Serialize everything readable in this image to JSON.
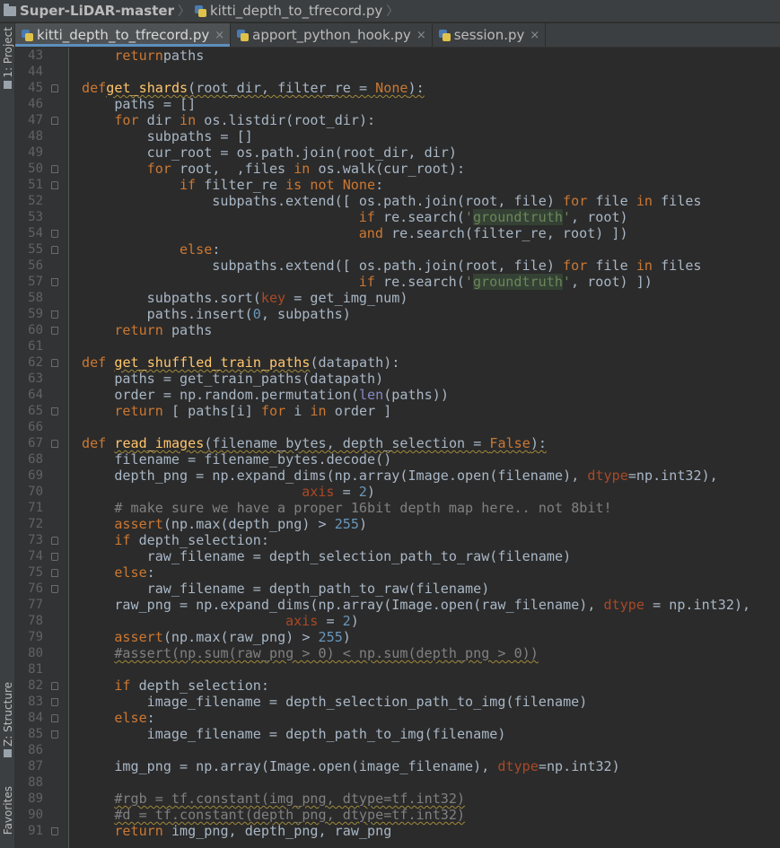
{
  "breadcrumb": {
    "project": "Super-LiDAR-master",
    "file": "kitti_depth_to_tfrecord.py"
  },
  "tool_strip": {
    "project": "1: Project",
    "structure": "Z: Structure",
    "favorites": "Favorites"
  },
  "tabs": [
    {
      "label": "kitti_depth_to_tfrecord.py",
      "active": true
    },
    {
      "label": "apport_python_hook.py",
      "active": false
    },
    {
      "label": "session.py",
      "active": false
    }
  ],
  "colors": {
    "keyword": "#cc7832",
    "function": "#ffc66d",
    "number": "#6897bb",
    "string": "#6a8759",
    "comment": "#808080",
    "kwarg": "#aa4926",
    "builtin": "#8888c6",
    "text": "#a9b7c6",
    "background": "#2b2b2b"
  },
  "lines": [
    {
      "n": 43,
      "ind": 1,
      "t": [
        [
          "kw",
          "return"
        ],
        [
          "",
          "paths"
        ]
      ]
    },
    {
      "n": 44,
      "ind": 0,
      "t": []
    },
    {
      "n": 45,
      "ind": 0,
      "t": [
        [
          "kw",
          "def"
        ],
        [
          "fn sq",
          "get_shards"
        ],
        [
          "sq",
          "(root_dir, filter_re = "
        ],
        [
          "kw sq",
          "None"
        ],
        [
          "sq",
          "):"
        ]
      ]
    },
    {
      "n": 46,
      "ind": 1,
      "t": [
        [
          "",
          "paths = []"
        ]
      ]
    },
    {
      "n": 47,
      "ind": 1,
      "t": [
        [
          "kw",
          "for "
        ],
        [
          "",
          "dir "
        ],
        [
          "kw",
          "in "
        ],
        [
          "",
          "os.listdir(root_dir):"
        ]
      ]
    },
    {
      "n": 48,
      "ind": 2,
      "t": [
        [
          "",
          "subpaths = []"
        ]
      ]
    },
    {
      "n": 49,
      "ind": 2,
      "t": [
        [
          "",
          "cur_root = os.path.join(root_dir, dir)"
        ]
      ]
    },
    {
      "n": 50,
      "ind": 2,
      "t": [
        [
          "kw",
          "for "
        ],
        [
          "",
          "root,  ,files "
        ],
        [
          "kw",
          "in "
        ],
        [
          "",
          "os.walk(cur_root):"
        ]
      ]
    },
    {
      "n": 51,
      "ind": 3,
      "t": [
        [
          "kw",
          "if "
        ],
        [
          "",
          "filter_re "
        ],
        [
          "kw",
          "is not "
        ],
        [
          "kw",
          "None"
        ],
        [
          "",
          ":"
        ]
      ]
    },
    {
      "n": 52,
      "ind": 4,
      "t": [
        [
          "",
          "subpaths.extend([ os.path.join(root, file) "
        ],
        [
          "kw",
          "for "
        ],
        [
          "",
          "file "
        ],
        [
          "kw",
          "in "
        ],
        [
          "",
          "files"
        ]
      ]
    },
    {
      "n": 53,
      "ind": 8.5,
      "t": [
        [
          "kw",
          "if "
        ],
        [
          "",
          "re.search("
        ],
        [
          "str",
          "'"
        ],
        [
          "str hl",
          "groundtruth"
        ],
        [
          "str",
          "'"
        ],
        [
          "",
          ", root)"
        ]
      ]
    },
    {
      "n": 54,
      "ind": 8.5,
      "t": [
        [
          "kw",
          "and "
        ],
        [
          "",
          "re.search(filter_re, root) ])"
        ]
      ]
    },
    {
      "n": 55,
      "ind": 3,
      "t": [
        [
          "kw",
          "else"
        ],
        [
          "",
          ":"
        ]
      ]
    },
    {
      "n": 56,
      "ind": 4,
      "t": [
        [
          "",
          "subpaths.extend([ os.path.join(root, file) "
        ],
        [
          "kw",
          "for "
        ],
        [
          "",
          "file "
        ],
        [
          "kw",
          "in "
        ],
        [
          "",
          "files"
        ]
      ]
    },
    {
      "n": 57,
      "ind": 8.5,
      "t": [
        [
          "kw",
          "if "
        ],
        [
          "",
          "re.search("
        ],
        [
          "str",
          "'"
        ],
        [
          "str hl",
          "groundtruth"
        ],
        [
          "str",
          "'"
        ],
        [
          "",
          ", root) ])"
        ]
      ]
    },
    {
      "n": 58,
      "ind": 2,
      "t": [
        [
          "",
          "subpaths.sort("
        ],
        [
          "kwarg",
          "key"
        ],
        [
          "",
          " = get_img_num)"
        ]
      ]
    },
    {
      "n": 59,
      "ind": 2,
      "t": [
        [
          "",
          "paths.insert("
        ],
        [
          "num",
          "0"
        ],
        [
          "",
          ", subpaths)"
        ]
      ]
    },
    {
      "n": 60,
      "ind": 1,
      "t": [
        [
          "kw",
          "return "
        ],
        [
          "",
          "paths"
        ]
      ]
    },
    {
      "n": 61,
      "ind": 0,
      "t": []
    },
    {
      "n": 62,
      "ind": 0,
      "t": [
        [
          "kw",
          "def "
        ],
        [
          "fn sq",
          "get_shuffled_train_paths"
        ],
        [
          "",
          "(datapath):"
        ]
      ]
    },
    {
      "n": 63,
      "ind": 1,
      "t": [
        [
          "",
          "paths = get_train_paths(datapath)"
        ]
      ]
    },
    {
      "n": 64,
      "ind": 1,
      "t": [
        [
          "",
          "order = np.random.permutation("
        ],
        [
          "bi",
          "len"
        ],
        [
          "",
          "(paths))"
        ]
      ]
    },
    {
      "n": 65,
      "ind": 1,
      "t": [
        [
          "kw",
          "return "
        ],
        [
          "",
          "[ paths[i] "
        ],
        [
          "kw",
          "for "
        ],
        [
          "",
          "i "
        ],
        [
          "kw",
          "in "
        ],
        [
          "",
          "order ]"
        ]
      ]
    },
    {
      "n": 66,
      "ind": 0,
      "t": []
    },
    {
      "n": 67,
      "ind": 0,
      "t": [
        [
          "kw",
          "def "
        ],
        [
          "fn sq",
          "read_images"
        ],
        [
          "sq",
          "(filename_bytes, depth_selection = "
        ],
        [
          "kw sq",
          "False"
        ],
        [
          "sq",
          "):"
        ]
      ]
    },
    {
      "n": 68,
      "ind": 1,
      "t": [
        [
          "",
          "filename = filename_bytes.decode()"
        ]
      ]
    },
    {
      "n": 69,
      "ind": 1,
      "t": [
        [
          "",
          "depth_png = np.expand_dims(np.array(Image.open(filename), "
        ],
        [
          "kwarg",
          "dtype"
        ],
        [
          "",
          "=np.int32),"
        ]
      ]
    },
    {
      "n": 70,
      "ind": 6.75,
      "t": [
        [
          "kwarg",
          "axis"
        ],
        [
          "",
          " = "
        ],
        [
          "num",
          "2"
        ],
        [
          "",
          ")"
        ]
      ]
    },
    {
      "n": 71,
      "ind": 1,
      "t": [
        [
          "cm",
          "# make sure we have a proper 16bit depth map here.. not 8bit!"
        ]
      ]
    },
    {
      "n": 72,
      "ind": 1,
      "t": [
        [
          "kw",
          "assert"
        ],
        [
          "",
          "(np.max(depth_png) > "
        ],
        [
          "num",
          "255"
        ],
        [
          "",
          ")"
        ]
      ]
    },
    {
      "n": 73,
      "ind": 1,
      "t": [
        [
          "kw",
          "if "
        ],
        [
          "",
          "depth_selection:"
        ]
      ]
    },
    {
      "n": 74,
      "ind": 2,
      "t": [
        [
          "",
          "raw_filename = depth_selection_path_to_raw(filename)"
        ]
      ]
    },
    {
      "n": 75,
      "ind": 1,
      "t": [
        [
          "kw",
          "else"
        ],
        [
          "",
          ":"
        ]
      ]
    },
    {
      "n": 76,
      "ind": 2,
      "t": [
        [
          "",
          "raw_filename = depth_path_to_raw(filename)"
        ]
      ]
    },
    {
      "n": 77,
      "ind": 1,
      "t": [
        [
          "",
          "raw_png = np.expand_dims(np.array(Image.open(raw_filename), "
        ],
        [
          "kwarg",
          "dtype"
        ],
        [
          "",
          " = np.int32),"
        ]
      ]
    },
    {
      "n": 78,
      "ind": 6.25,
      "t": [
        [
          "kwarg",
          "axis"
        ],
        [
          "",
          " = "
        ],
        [
          "num",
          "2"
        ],
        [
          "",
          ")"
        ]
      ]
    },
    {
      "n": 79,
      "ind": 1,
      "t": [
        [
          "kw",
          "assert"
        ],
        [
          "",
          "(np.max(raw_png) > "
        ],
        [
          "num",
          "255"
        ],
        [
          "",
          ")"
        ]
      ]
    },
    {
      "n": 80,
      "ind": 1,
      "t": [
        [
          "cm sq",
          "#assert(np.sum(raw_png > 0) < np.sum(depth_png > 0))"
        ]
      ]
    },
    {
      "n": 81,
      "ind": 0,
      "t": []
    },
    {
      "n": 82,
      "ind": 1,
      "t": [
        [
          "kw",
          "if "
        ],
        [
          "",
          "depth_selection:"
        ]
      ]
    },
    {
      "n": 83,
      "ind": 2,
      "t": [
        [
          "",
          "image_filename = depth_selection_path_to_img(filename)"
        ]
      ]
    },
    {
      "n": 84,
      "ind": 1,
      "t": [
        [
          "kw",
          "else"
        ],
        [
          "",
          ":"
        ]
      ]
    },
    {
      "n": 85,
      "ind": 2,
      "t": [
        [
          "",
          "image_filename = depth_path_to_img(filename)"
        ]
      ]
    },
    {
      "n": 86,
      "ind": 0,
      "t": []
    },
    {
      "n": 87,
      "ind": 1,
      "t": [
        [
          "",
          "img_png = np.array(Image.open(image_filename), "
        ],
        [
          "kwarg",
          "dtype"
        ],
        [
          "",
          "=np.int32)"
        ]
      ]
    },
    {
      "n": 88,
      "ind": 0,
      "t": []
    },
    {
      "n": 89,
      "ind": 1,
      "t": [
        [
          "cm sq",
          "#rgb = tf.constant(img_png, dtype=tf.int32)"
        ]
      ]
    },
    {
      "n": 90,
      "ind": 1,
      "t": [
        [
          "cm sq",
          "#d = tf.constant(depth_png, dtype=tf.int32)"
        ]
      ]
    },
    {
      "n": 91,
      "ind": 1,
      "t": [
        [
          "kw",
          "return "
        ],
        [
          "",
          "img_png, depth_png, raw_png"
        ]
      ]
    }
  ]
}
